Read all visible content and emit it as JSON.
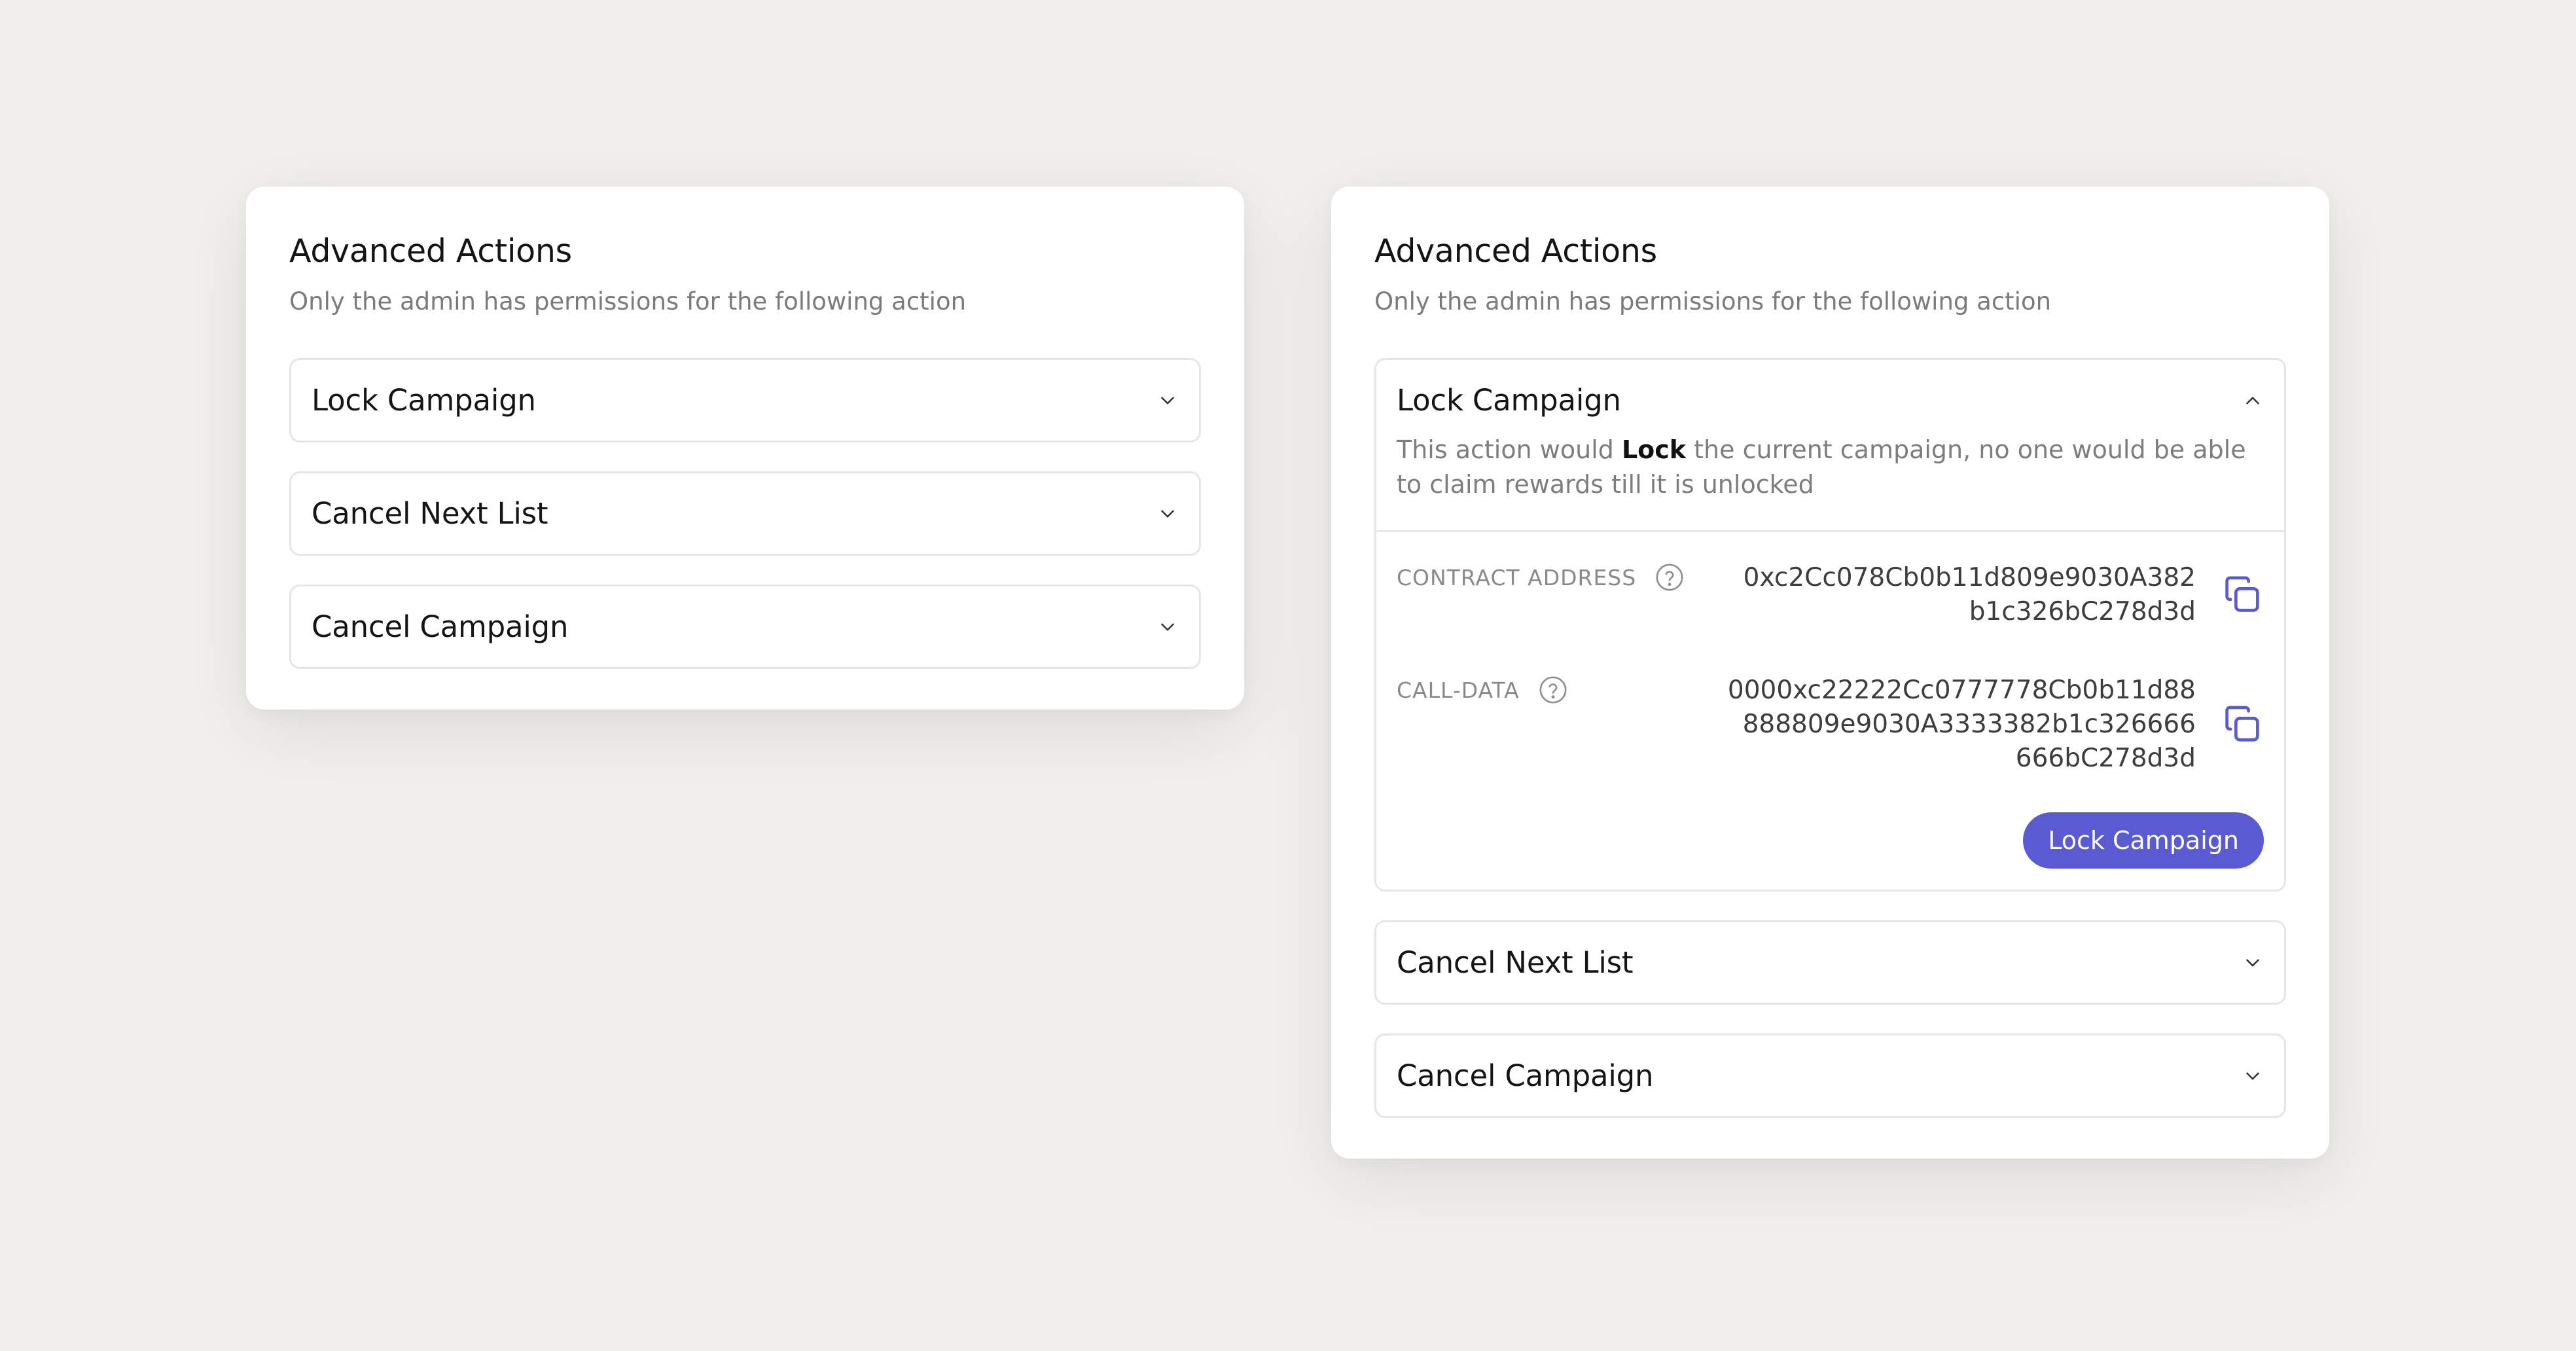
{
  "colors": {
    "accent": "#5a5ad3",
    "background": "#f1f0ed",
    "card": "#ffffff",
    "muted_text": "#7b7b7b"
  },
  "left_card": {
    "title": "Advanced Actions",
    "subtitle": "Only the admin has permissions for the following action",
    "items": [
      {
        "label": "Lock Campaign",
        "icon": "chevron-down-icon"
      },
      {
        "label": "Cancel Next List",
        "icon": "chevron-down-icon"
      },
      {
        "label": "Cancel Campaign",
        "icon": "chevron-down-icon"
      }
    ]
  },
  "right_card": {
    "title": "Advanced Actions",
    "subtitle": "Only the admin has permissions for the following action",
    "expanded_item": {
      "label": "Lock Campaign",
      "icon": "chevron-up-icon",
      "description_before": "This action would ",
      "description_bold": "Lock",
      "description_after": " the current campaign, no one would be able to claim rewards till it is unlocked",
      "fields": [
        {
          "key": "CONTRACT ADDRESS",
          "value": "0xc2Cc078Cb0b11d809e9030A382\nb1c326bC278d3d",
          "help_icon": "question-circle-icon",
          "action_icon": "copy-icon"
        },
        {
          "key": "CALL-DATA",
          "value": "0000xc22222Cc0777778Cb0b11d88\n888809e9030A3333382b1c326666\n666bC278d3d",
          "help_icon": "question-circle-icon",
          "action_icon": "copy-icon"
        }
      ],
      "button_label": "Lock Campaign"
    },
    "items": [
      {
        "label": "Cancel Next List",
        "icon": "chevron-down-icon"
      },
      {
        "label": "Cancel Campaign",
        "icon": "chevron-down-icon"
      }
    ]
  }
}
